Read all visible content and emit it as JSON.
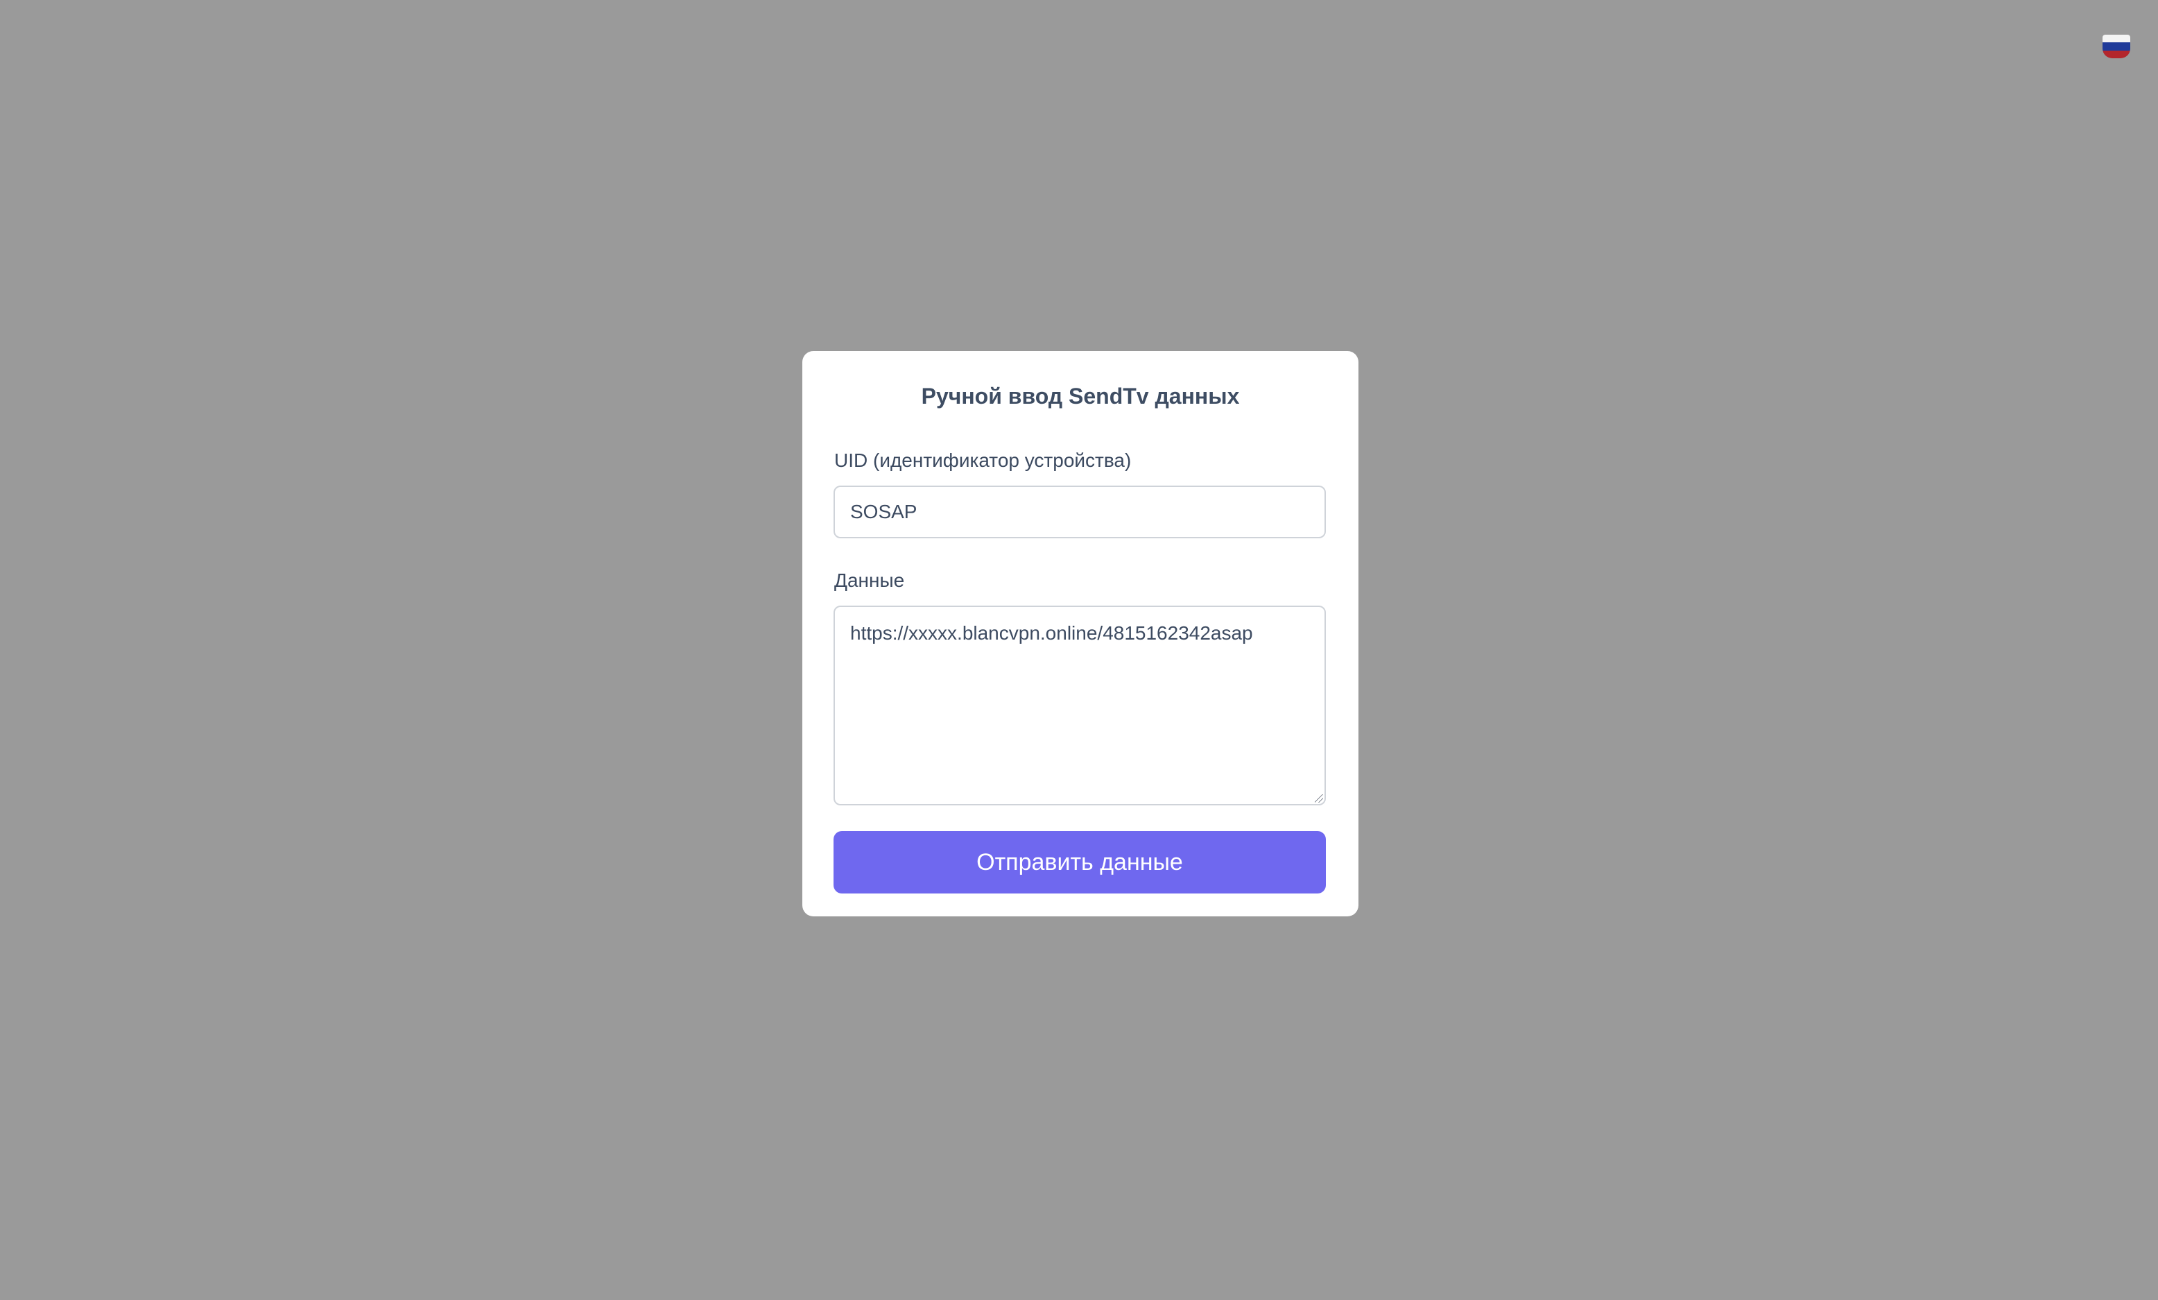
{
  "header": {
    "language_flag_icon": "russia-flag-icon",
    "language_code": "ru"
  },
  "modal": {
    "title": "Ручной ввод SendTv данных",
    "uid_label": "UID (идентификатор устройства)",
    "uid_value": "SOSAP",
    "data_label": "Данные",
    "data_value": "https://xxxxx.blancvpn.online/4815162342asap",
    "submit_label": "Отправить данные"
  },
  "colors": {
    "overlay": "#9a9a9a",
    "button": "#6f68ef",
    "text": "#3e4d63"
  }
}
